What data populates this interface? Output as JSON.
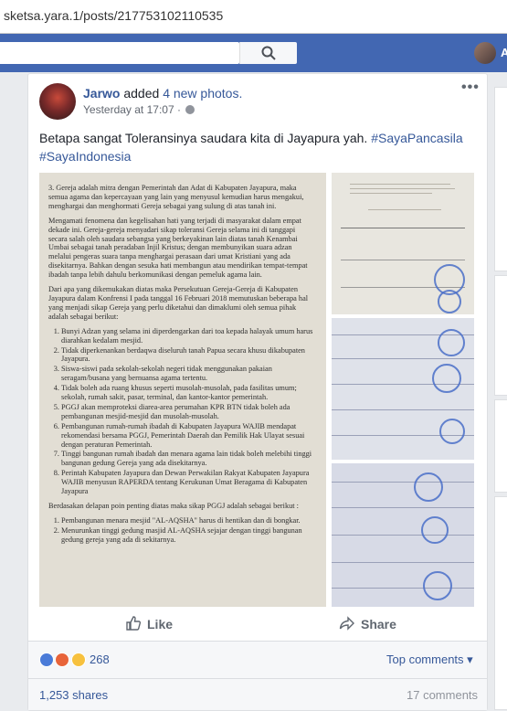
{
  "browser": {
    "url": "sketsa.yara.1/posts/217753102110535"
  },
  "topbar": {
    "user_name": "A"
  },
  "post": {
    "author": "Jarwo",
    "action": "added",
    "photos_link": "4 new photos.",
    "timestamp": "Yesterday at 17:07",
    "dot": "·",
    "more": "•••",
    "text": "Betapa sangat Toleransinya saudara kita di Jayapura yah.",
    "hashtag1": "#SayaPancasila",
    "hashtag2": "#SayaIndonesia"
  },
  "document": {
    "item3": "3.   Gereja adalah mitra dengan Pemerintah dan Adat di Kabupaten Jayapura, maka semua agama dan kepercayaan yang lain yang menyusul kemudian harus mengakui, menghargai dan menghormati Gereja sebagai yang sulung di atas tanah ini.",
    "para1": "Mengamati fenomena dan kegelisahan hati yang terjadi di masyarakat dalam empat dekade ini. Gereja-gereja menyadari sikap toleransi Gereja selama ini di tanggapi secara salah oleh saudara sebangsa yang berkeyakinan lain diatas tanah Kenambai Umbai sebagai tanah peradaban Injil Kristus; dengan membunyikan suara adzan melalui pengeras suara tanpa menghargai perasaan dari umat Kristiani yang ada disekitarnya. Bahkan dengan sesuka hati membangun atau mendirikan tempat-tempat ibadah tanpa lebih dahulu berkomunikasi dengan pemeluk agama lain.",
    "para2": "Dari apa yang dikemukakan diatas maka Persekutuan Gereja-Gereja di Kabupaten Jayapura dalam Konfrensi I pada tanggal 16 Februari 2018 memutuskan beberapa hal yang menjadi sikap Gereja yang perlu diketahui dan dimaklumi oleh semua pihak adalah sebagai berikut:",
    "points": [
      "Bunyi Adzan yang selama ini diperdengarkan dari toa kepada halayak umum harus diarahkan kedalam mesjid.",
      "Tidak diperkenankan berdaqwa diseluruh tanah Papua secara khusu dikabupaten Jayapura.",
      "Siswa-siswi pada sekolah-sekolah negeri tidak menggunakan pakaian seragam/busana yang bernuansa agama tertentu.",
      "Tidak boleh ada ruang khusus seperti musolah-musolah, pada fasilitas umum; sekolah, rumah sakit, pasar, terminal, dan kantor-kantor pemerintah.",
      "PGGJ akan memproteksi diarea-area perumahan KPR BTN tidak boleh ada pembangunan mesjid-mesjid dan musolah-musolah.",
      "Pembangunan rumah-rumah ibadah di Kabupaten Jayapura WAJIB mendapat rekomendasi bersama PGGJ, Pemerintah Daerah dan Pemilik Hak Ulayat sesuai dengan peraturan Pemerintah.",
      "Tinggi bangunan rumah ibadah dan menara agama lain tidak boleh melebihi tinggi bangunan gedung Gereja yang ada disekitarnya.",
      "Perintah Kabupaten Jayapura dan Dewan Perwakilan Rakyat Kabupaten Jayapura WAJIB menyusun RAPERDA tentang Kerukunan Umat Beragama di Kabupaten Jayapura"
    ],
    "para3": "Berdasakan delapan poin penting diatas maka sikap PGGJ adalah sebagai berikut :",
    "points2": [
      "Pembangunan menara mesjid \"AL-AQSHA\" harus di hentikan dan di bongkar.",
      "Menurunkan tinggi gedung masjid AL-AQSHA sejajar dengan tinggi bangunan gedung gereja yang ada di sekitarnya."
    ]
  },
  "actions": {
    "like": "Like",
    "share": "Share"
  },
  "reactions": {
    "count": "268",
    "top_comments": "Top comments ▾"
  },
  "footer": {
    "shares": "1,253 shares",
    "comments": "17 comments"
  },
  "colors": {
    "facebook_blue": "#4267b2",
    "link": "#365899"
  }
}
